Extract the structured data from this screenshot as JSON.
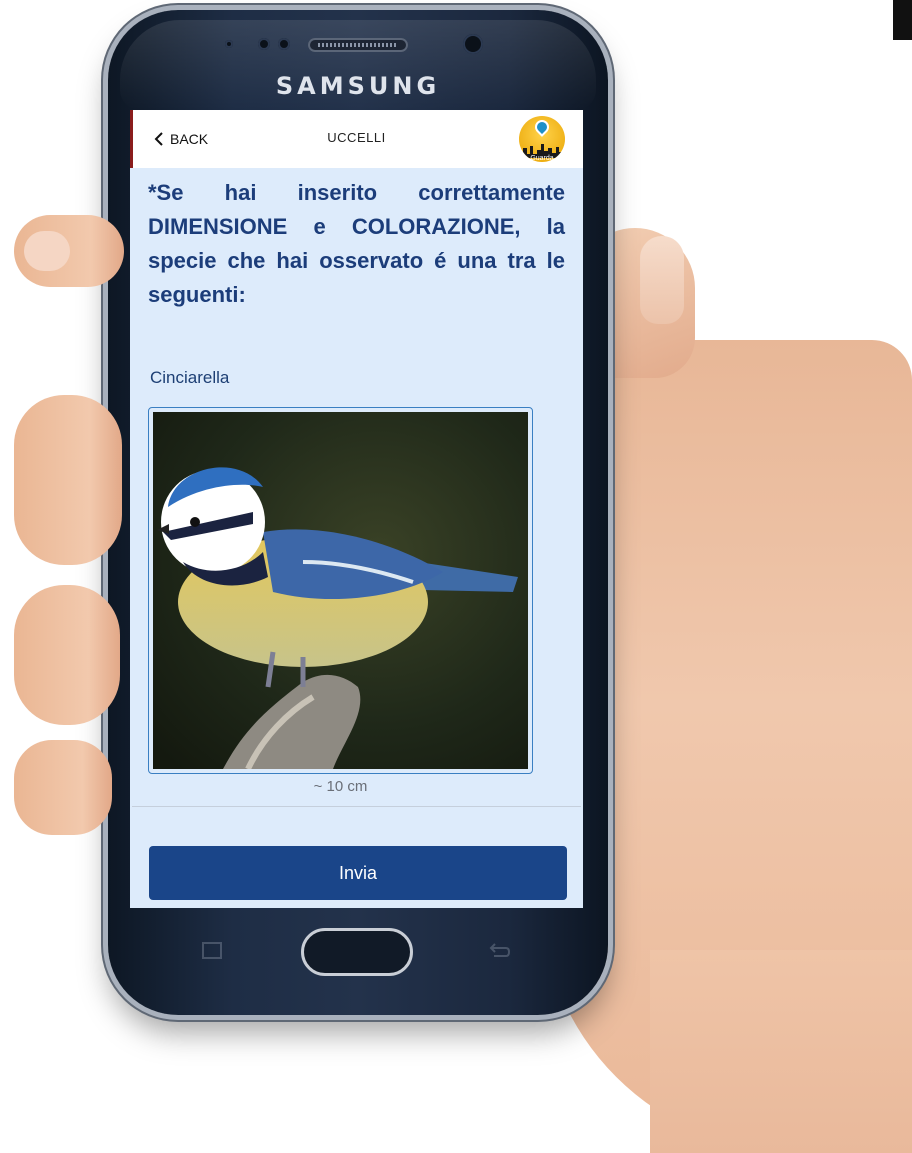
{
  "device": {
    "brand": "SAMSUNG"
  },
  "header": {
    "back_label": "BACK",
    "title": "UCCELLI",
    "logo_text": "Guarda"
  },
  "main": {
    "intro_text": "*Se hai inserito correttamente DIMENSIONE e COLORAZIONE, la specie che hai osservato é una tra le seguenti:",
    "species": [
      {
        "name": "Cinciarella",
        "size": "~ 10 cm",
        "image": "blue tit bird perched on branch"
      }
    ],
    "submit_label": "Invia"
  },
  "colors": {
    "header_bg": "#ffffff",
    "screen_bg": "#ddebfb",
    "text_primary": "#1c3d7a",
    "button_bg": "#1a4589",
    "button_text": "#ffffff"
  },
  "icons": {
    "back": "chevron-left-icon",
    "logo": "map-pin-skyline-logo"
  }
}
